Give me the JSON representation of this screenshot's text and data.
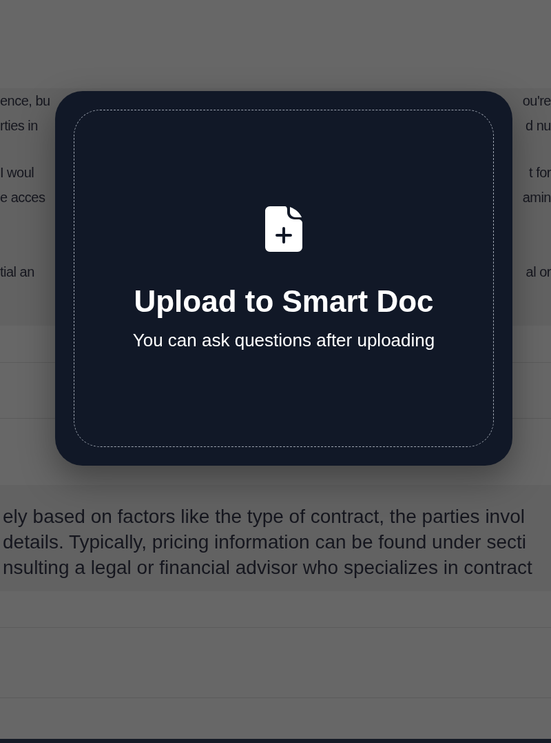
{
  "background_chat": {
    "messages": [
      {
        "paragraphs": [
          [
            {
              "left": "ence, bu",
              "right": "ou're"
            },
            {
              "left": "rties in",
              "right": "d nu"
            }
          ],
          [
            {
              "left": "I woul",
              "right": "t for"
            },
            {
              "left": "e acces",
              "right": "amin"
            }
          ],
          [
            {
              "left": "tial an",
              "right": "al or"
            }
          ]
        ]
      },
      {
        "paragraphs": [
          [
            {
              "text": "ely based on factors like the type of contract, the parties invol"
            },
            {
              "text": "details. Typically, pricing information can be found under secti"
            },
            {
              "text": "nsulting a legal or financial advisor who specializes in contract"
            }
          ]
        ]
      }
    ]
  },
  "upload_dialog": {
    "title": "Upload to Smart Doc",
    "subtitle": "You can ask questions after uploading"
  }
}
